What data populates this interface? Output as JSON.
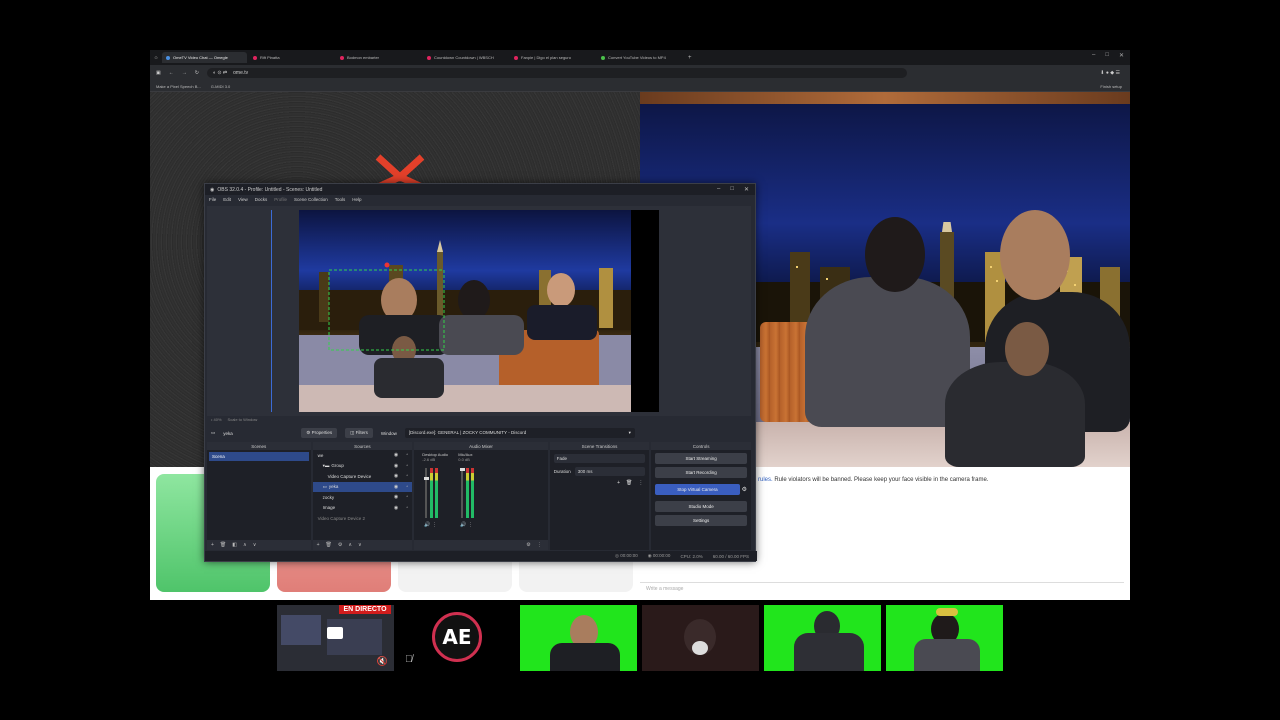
{
  "browser": {
    "tabs": [
      {
        "label": "OmeTV Video Chat — Omegle",
        "color": "#4a90e2",
        "active": true
      },
      {
        "label": "Rift Pinatta",
        "color": "#e0245e"
      },
      {
        "label": "Bodmon embarter",
        "color": "#e0245e"
      },
      {
        "label": "Countdown Countdown | WBSCH",
        "color": "#e0245e"
      },
      {
        "label": "Fanpie | Digo el plan seguro",
        "color": "#e0245e"
      },
      {
        "label": "Convert YouTube Videos to MP4",
        "color": "#4ac04a"
      }
    ],
    "url": "ome.tv",
    "bookmarks": [
      "Make a Pixel Speech B...",
      "G-MIDI 3.0"
    ],
    "finish_setup": "Finish setup",
    "window_controls": [
      "–",
      "□",
      "✕"
    ]
  },
  "chat": {
    "rules_prefix": "rules.",
    "rules_link": "rules",
    "rules_text": " Rule violators will be banned. Please keep your face visible in the camera frame.",
    "input_placeholder": "Write a message"
  },
  "obs": {
    "title": "OBS 32.0.4 - Profile: Untitled - Scenes: Untitled",
    "window_controls": [
      "–",
      "□",
      "✕"
    ],
    "menu": [
      "File",
      "Edit",
      "View",
      "Docks",
      "Profile",
      "Scene Collection",
      "Tools",
      "Help"
    ],
    "preview_status": [
      "• 40%",
      "Scale to Window"
    ],
    "context": {
      "source_name": "yeka",
      "properties": "Properties",
      "filters": "Filters",
      "window_label": "Window",
      "window_value": "[Discord.exe]: GENERAL | ZOCKY COMMUNITY - Discord"
    },
    "docks": {
      "scenes": {
        "title": "Scenes",
        "items": [
          "Scena"
        ]
      },
      "sources": {
        "title": "Sources",
        "items": [
          {
            "name": "we",
            "indent": 0
          },
          {
            "name": "Group",
            "indent": 1
          },
          {
            "name": "Video Capture Device",
            "indent": 2
          },
          {
            "name": "yeka",
            "indent": 1,
            "selected": true
          },
          {
            "name": "zocky",
            "indent": 1
          },
          {
            "name": "Image",
            "indent": 1
          },
          {
            "name": "Video Capture Device 2",
            "indent": 0
          }
        ]
      },
      "mixer": {
        "title": "Audio Mixer",
        "channels": [
          {
            "name": "Desktop Audio",
            "db": "-2.6 dB",
            "level": 0.8
          },
          {
            "name": "Mic/Aux",
            "db": "0.0 dB",
            "level": 1.0
          }
        ]
      },
      "transitions": {
        "title": "Scene Transitions",
        "type": "Fade",
        "duration_label": "Duration",
        "duration": "300 ms"
      },
      "controls": {
        "title": "Controls",
        "buttons": [
          "Start Streaming",
          "Start Recording",
          "Stop Virtual Camera",
          "Studio Mode",
          "Settings"
        ]
      }
    },
    "status": {
      "rec": "00:00:00",
      "stream": "00:00:00",
      "cpu": "CPU: 2.0%",
      "fps": "60.00 / 60.00 FPS"
    }
  },
  "bottom": {
    "live_badge": "EN DIRECTO",
    "logo_text": "AE"
  },
  "colors": {
    "obs_bg": "#272a33",
    "selection": "#2e4a8a",
    "green_screen": "#21e51c",
    "live_red": "#d11d1d"
  }
}
